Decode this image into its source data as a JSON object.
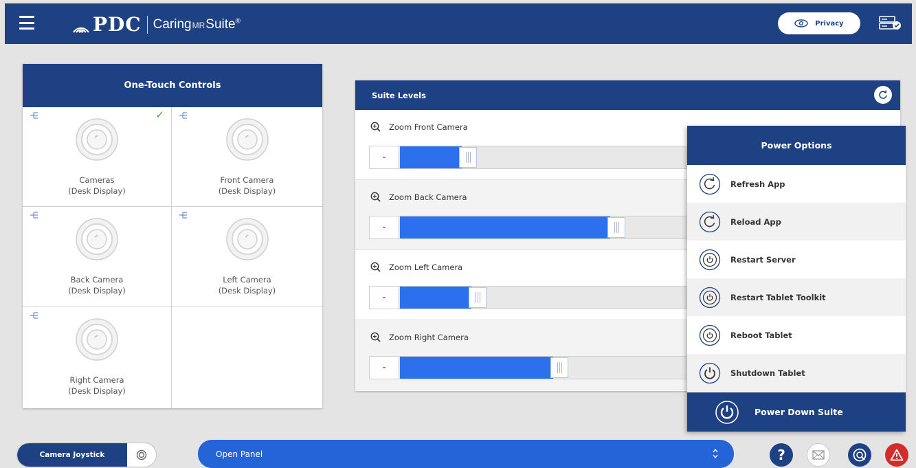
{
  "header": {
    "brand": "PDC",
    "product_prefix": "Caring",
    "product_mr": "MR",
    "product_suffix": "Suite",
    "product_reg": "®",
    "privacy_label": "Privacy"
  },
  "one_touch": {
    "title": "One-Touch Controls",
    "cells": [
      {
        "line1": "Cameras",
        "line2": "(Desk Display)",
        "checked": true
      },
      {
        "line1": "Front Camera",
        "line2": "(Desk Display)",
        "checked": false
      },
      {
        "line1": "Back Camera",
        "line2": "(Desk Display)",
        "checked": false
      },
      {
        "line1": "Left Camera",
        "line2": "(Desk Display)",
        "checked": false
      },
      {
        "line1": "Right Camera",
        "line2": "(Desk Display)",
        "checked": false
      }
    ],
    "check_glyph": "✓"
  },
  "suite_levels": {
    "title": "Suite Levels",
    "minus_label": "-",
    "rows": [
      {
        "label": "Zoom Front Camera",
        "level": 0.13
      },
      {
        "label": "Zoom Back Camera",
        "level": 0.44
      },
      {
        "label": "Zoom Left Camera",
        "level": 0.15
      },
      {
        "label": "Zoom Right Camera",
        "level": 0.32
      }
    ]
  },
  "power_options": {
    "title": "Power Options",
    "items": [
      {
        "label": "Refresh App",
        "icon": "refresh-icon"
      },
      {
        "label": "Reload App",
        "icon": "reload-icon"
      },
      {
        "label": "Restart Server",
        "icon": "restart-server-icon"
      },
      {
        "label": "Restart Tablet Toolkit",
        "icon": "restart-toolkit-icon"
      },
      {
        "label": "Reboot Tablet",
        "icon": "reboot-icon"
      },
      {
        "label": "Shutdown Tablet",
        "icon": "power-icon"
      }
    ],
    "footer_label": "Power Down Suite"
  },
  "bottom_bar": {
    "joystick_label": "Camera Joystick",
    "open_panel_label": "Open Panel",
    "help_glyph": "?"
  },
  "colors": {
    "brand_navy": "#1e4184",
    "accent_blue": "#2d70ee",
    "alert_red": "#d42b2b",
    "check_green": "#4aa04a"
  }
}
